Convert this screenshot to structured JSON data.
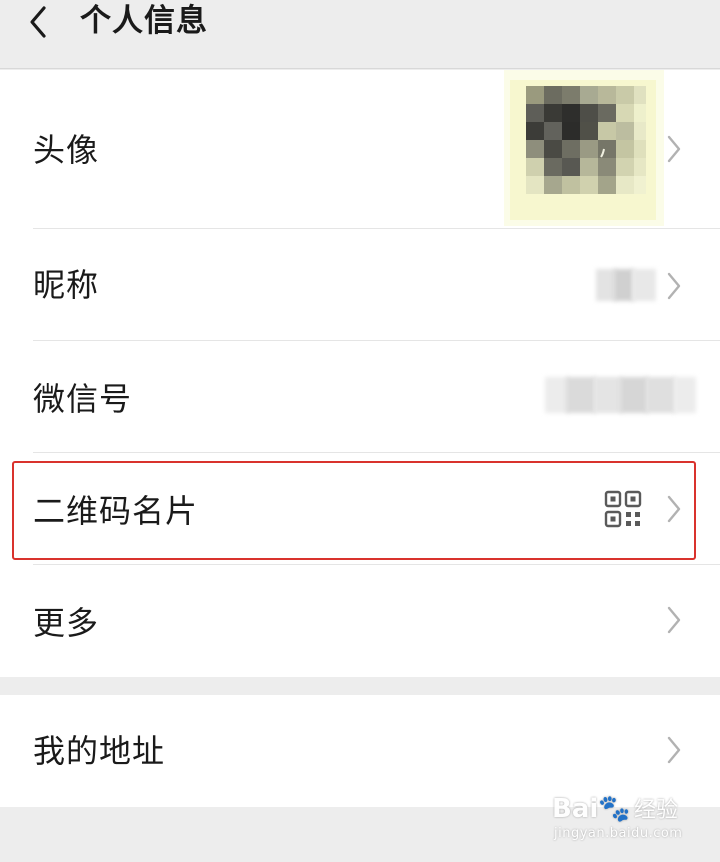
{
  "header": {
    "title": "个人信息",
    "back_icon": "chevron-left-icon"
  },
  "profile_items": [
    {
      "label": "头像",
      "value_type": "avatar-image"
    },
    {
      "label": "昵称",
      "value_type": "blurred-text"
    },
    {
      "label": "微信号",
      "value_type": "blurred-text"
    },
    {
      "label": "二维码名片",
      "value_type": "qr-code-icon"
    },
    {
      "label": "更多",
      "value_type": "none"
    }
  ],
  "extra_items": [
    {
      "label": "我的地址"
    }
  ],
  "highlight": {
    "target": "二维码名片",
    "color": "#d9322d"
  },
  "colors": {
    "background": "#ededed",
    "card": "#ffffff",
    "text": "#1a1a1a",
    "chevron": "#b2b2b2",
    "highlight": "#d9322d"
  },
  "watermark": {
    "brand": "Bai🐾",
    "sub": "经验",
    "url": "jingyan.baidu.com"
  }
}
